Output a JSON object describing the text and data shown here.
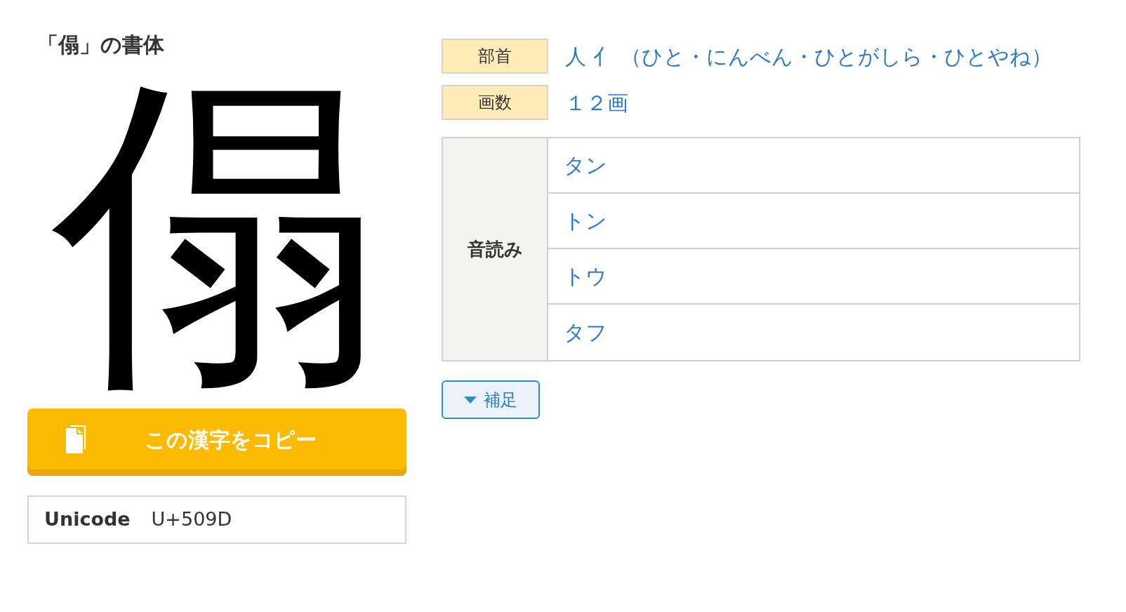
{
  "title": "「傝」の書体",
  "glyph": "傝",
  "copy_button": "この漢字をコピー",
  "unicode": {
    "label": "Unicode",
    "value": "U+509D"
  },
  "info": [
    {
      "label": "部首",
      "value": "人 亻 （ひと・にんべん・ひとがしら・ひとやね）"
    },
    {
      "label": "画数",
      "value": "１２画"
    }
  ],
  "readings": {
    "label": "音読み",
    "items": [
      "タン",
      "トン",
      "トウ",
      "タフ"
    ]
  },
  "supplement_button": {
    "label": "補足",
    "expanded": false
  }
}
